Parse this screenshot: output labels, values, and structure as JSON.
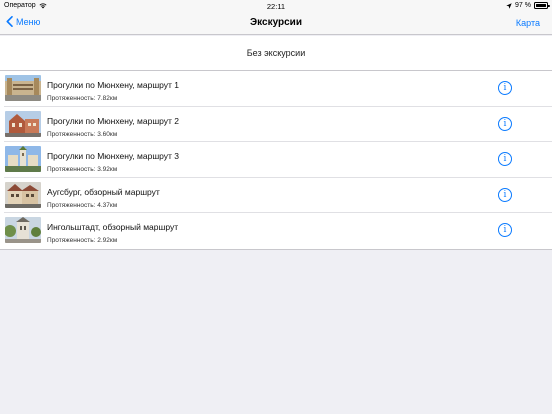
{
  "status": {
    "carrier": "Оператор",
    "time": "22:11",
    "battery": "97 %"
  },
  "nav": {
    "back_label": "Меню",
    "title": "Экскурсии",
    "right_label": "Карта"
  },
  "no_excursion": "Без экскурсии",
  "tours": [
    {
      "title": "Прогулки по Мюнхену, маршрут 1",
      "distance": "Протяженность: 7.82км"
    },
    {
      "title": "Прогулки по Мюнхену, маршрут 2",
      "distance": "Протяженность: 3.60км"
    },
    {
      "title": "Прогулки по Мюнхену, маршрут 3",
      "distance": "Протяженность: 3.92км"
    },
    {
      "title": "Аугсбург, обзорный маршрут",
      "distance": "Протяженность: 4.37км"
    },
    {
      "title": "Ингольштадт, обзорный маршрут",
      "distance": "Протяженность: 2.92км"
    }
  ],
  "icons": {
    "wifi": "wifi-icon",
    "location": "location-arrow-icon",
    "battery": "battery-icon",
    "back": "chevron-left-icon",
    "info": "info-circle-icon"
  },
  "colors": {
    "accent": "#0a7aff",
    "background": "#efeff4"
  }
}
